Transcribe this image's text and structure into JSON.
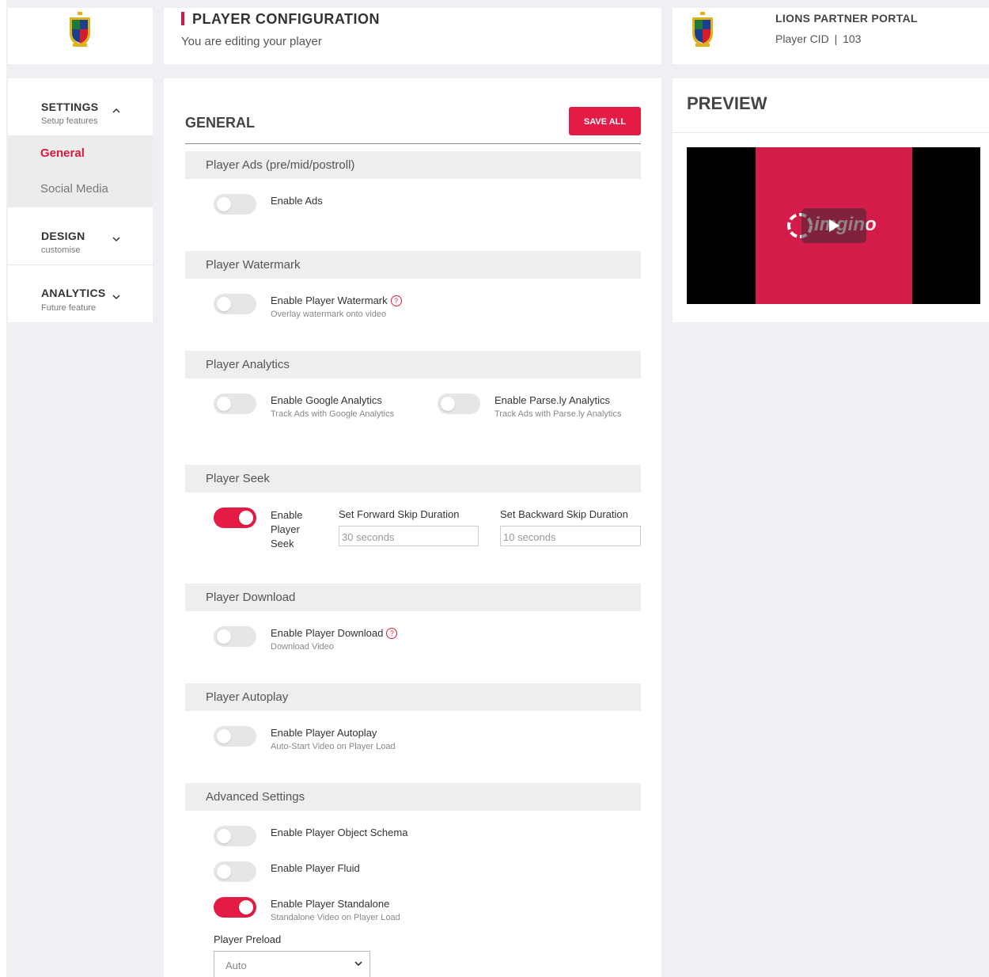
{
  "header": {
    "title": "PLAYER CONFIGURATION",
    "subtitle": "You are editing your player"
  },
  "portal": {
    "title": "LIONS PARTNER PORTAL",
    "cid_label": "Player CID",
    "cid_sep": "|",
    "cid_value": "103"
  },
  "sidebar": {
    "settings": {
      "title": "SETTINGS",
      "sub": "Setup features",
      "icon": "chevron-up-icon"
    },
    "items": [
      {
        "label": "General",
        "active": true
      },
      {
        "label": "Social Media",
        "active": false
      }
    ],
    "design": {
      "title": "DESIGN",
      "sub": "customise",
      "icon": "chevron-down-icon"
    },
    "analytics": {
      "title": "ANALYTICS",
      "sub": "Future feature",
      "icon": "chevron-down-icon"
    }
  },
  "main": {
    "heading": "GENERAL",
    "save_label": "SAVE ALL",
    "sections": {
      "ads": {
        "title": "Player Ads (pre/mid/postroll)",
        "toggle": "Enable Ads"
      },
      "watermark": {
        "title": "Player Watermark",
        "toggle": "Enable Player Watermark",
        "sub": "Overlay watermark onto video"
      },
      "analytics": {
        "title": "Player Analytics",
        "ga": {
          "toggle": "Enable Google Analytics",
          "sub": "Track Ads with Google Analytics"
        },
        "parsely": {
          "toggle": "Enable Parse.ly Analytics",
          "sub": "Track Ads with Parse.ly Analytics"
        }
      },
      "seek": {
        "title": "Player Seek",
        "toggle_line1": "Enable",
        "toggle_line2": "Player",
        "toggle_line3": "Seek",
        "forward_label": "Set Forward Skip Duration",
        "forward_placeholder": "30 seconds",
        "backward_label": "Set Backward Skip Duration",
        "backward_placeholder": "10 seconds"
      },
      "download": {
        "title": "Player Download",
        "toggle": "Enable Player Download",
        "sub": "Download Video"
      },
      "autoplay": {
        "title": "Player Autoplay",
        "toggle": "Enable Player Autoplay",
        "sub": "Auto-Start Video on Player Load"
      },
      "advanced": {
        "title": "Advanced Settings",
        "schema": "Enable Player Object Schema",
        "fluid": "Enable Player Fluid",
        "standalone": "Enable Player Standalone",
        "standalone_sub": "Standalone Video on Player Load",
        "preload_label": "Player Preload",
        "preload_value": "Auto"
      }
    },
    "toggle_states": {
      "ads": false,
      "watermark": false,
      "ga": false,
      "parsely": false,
      "seek": true,
      "download": false,
      "autoplay": false,
      "schema": false,
      "fluid": false,
      "standalone": true
    }
  },
  "preview": {
    "title": "PREVIEW",
    "brand": "imgino",
    "play_icon": "play-icon"
  },
  "colors": {
    "accent": "#e31b45",
    "background": "#eef0f3",
    "video_bg": "#d41c4a"
  }
}
